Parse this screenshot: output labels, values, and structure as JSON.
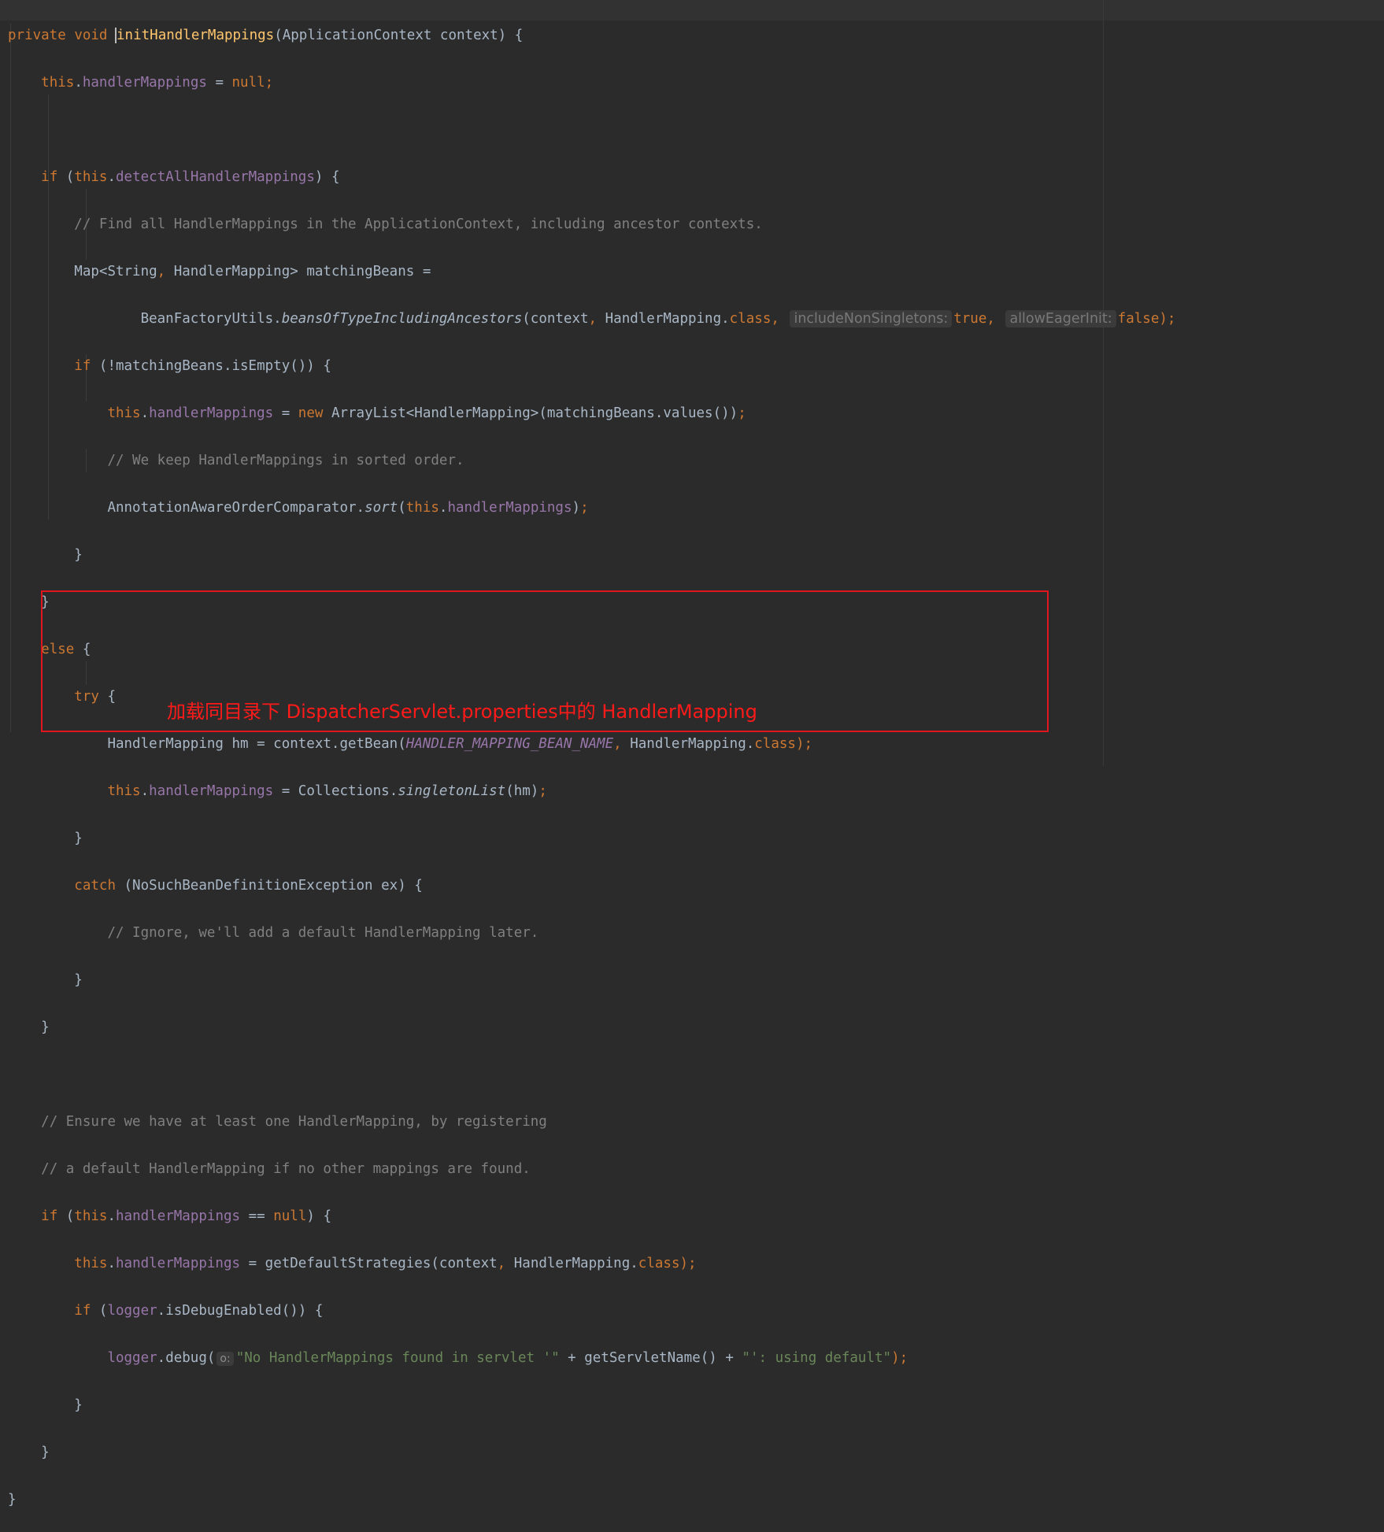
{
  "editor": {
    "colors": {
      "background": "#2b2b2b",
      "keyword": "#cc7832",
      "field": "#9876aa",
      "method_declaration": "#ffc66d",
      "comment": "#808080",
      "string": "#6a8759",
      "default_text": "#a9b7c6",
      "annotation_box": "#e0161e"
    },
    "code": {
      "l1": {
        "private": "private",
        "void": "void",
        "method": "initHandlerMappings",
        "params": "(ApplicationContext context) {"
      },
      "l2": {
        "this": "this",
        "field": "handlerMappings",
        "assign": " = ",
        "null": "null",
        "semi": ";"
      },
      "l4": {
        "if": "if",
        "open": " (",
        "this": "this",
        "field": "detectAllHandlerMappings",
        "close": ") {"
      },
      "l5": {
        "comment": "// Find all HandlerMappings in the ApplicationContext, including ancestor contexts."
      },
      "l6": {
        "text_a": "Map<String",
        "comma": ",",
        "text_b": " HandlerMapping> matchingBeans ="
      },
      "l7": {
        "cls": "BeanFactoryUtils.",
        "method": "beansOfTypeIncludingAncestors",
        "args_a": "(context",
        "comma1": ",",
        "args_b": " HandlerMapping.",
        "class_kw": "class",
        "comma2": ",",
        "hint1": "includeNonSingletons:",
        "true_kw": "true",
        "comma3": ",",
        "hint2": "allowEagerInit:",
        "false_kw": "false",
        "end": ");"
      },
      "l8": {
        "if": "if",
        "text": " (!matchingBeans.isEmpty()) {"
      },
      "l9": {
        "this": "this",
        "field": "handlerMappings",
        "assign": " = ",
        "new": "new",
        "text": " ArrayList<HandlerMapping>(matchingBeans.values())",
        "semi": ";"
      },
      "l10": {
        "comment": "// We keep HandlerMappings in sorted order."
      },
      "l11": {
        "cls": "AnnotationAwareOrderComparator.",
        "method": "sort",
        "open": "(",
        "this": "this",
        "field": "handlerMappings",
        "close": ")",
        "semi": ";"
      },
      "l12": {
        "brace": "}"
      },
      "l13": {
        "brace": "}"
      },
      "l14": {
        "else": "else",
        "brace": " {"
      },
      "l15": {
        "try": "try",
        "brace": " {"
      },
      "l16": {
        "text_a": "HandlerMapping hm = context.getBean(",
        "const": "HANDLER_MAPPING_BEAN_NAME",
        "comma": ",",
        "text_b": " HandlerMapping.",
        "class_kw": "class",
        "end": ");"
      },
      "l17": {
        "this": "this",
        "field": "handlerMappings",
        "text_a": " = Collections.",
        "method": "singletonList",
        "text_b": "(hm)",
        "semi": ";"
      },
      "l18": {
        "brace": "}"
      },
      "l19": {
        "catch": "catch",
        "text": " (NoSuchBeanDefinitionException ex) {"
      },
      "l20": {
        "comment": "// Ignore, we'll add a default HandlerMapping later."
      },
      "l21": {
        "brace": "}"
      },
      "l22": {
        "brace": "}"
      },
      "l24": {
        "comment": "// Ensure we have at least one HandlerMapping, by registering"
      },
      "l25": {
        "comment": "// a default HandlerMapping if no other mappings are found."
      },
      "l26": {
        "if": "if",
        "open": " (",
        "this": "this",
        "field": "handlerMappings",
        "eq": " == ",
        "null": "null",
        "close": ") {"
      },
      "l27": {
        "this": "this",
        "field": "handlerMappings",
        "text_a": " = getDefaultStrategies(context",
        "comma": ",",
        "text_b": " HandlerMapping.",
        "class_kw": "class",
        "end": ");"
      },
      "l28": {
        "if": "if",
        "open": " (",
        "field": "logger",
        "text": ".isDebugEnabled()) {"
      },
      "l29": {
        "field": "logger",
        "text_a": ".debug(",
        "hint": "o:",
        "str_a": "\"No HandlerMappings found in servlet '\"",
        "plus1": " + getServletName() + ",
        "str_b": "\"': using default\"",
        "end": ");"
      },
      "l30": {
        "brace": "}"
      },
      "l31": {
        "brace": "}"
      },
      "l32": {
        "brace": "}"
      }
    }
  },
  "annotation": {
    "text": "加载同目录下 DispatcherServlet.properties中的 HandlerMapping"
  }
}
